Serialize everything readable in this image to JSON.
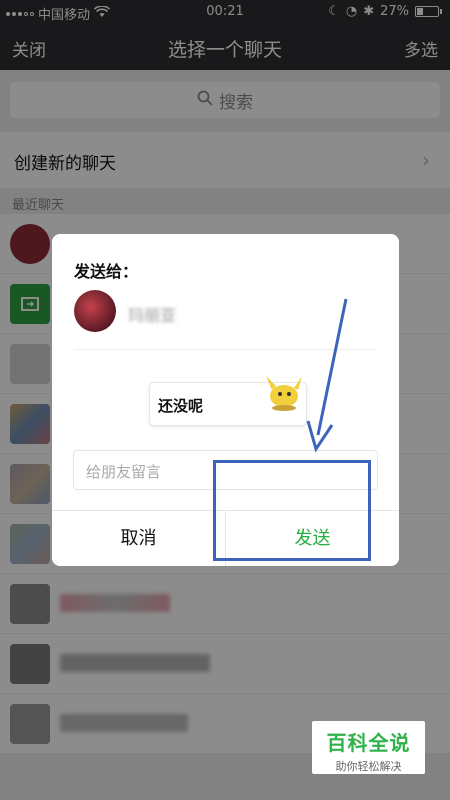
{
  "status_bar": {
    "carrier": "中国移动",
    "time": "00:21",
    "battery": "27%"
  },
  "nav": {
    "close": "关闭",
    "title": "选择一个聊天",
    "multi_select": "多选"
  },
  "search": {
    "placeholder": "搜索"
  },
  "create_chat": {
    "label": "创建新的聊天"
  },
  "recent": {
    "header": "最近聊天",
    "rows": [
      {
        "avatar_color": "#8b2b35"
      },
      {
        "avatar_color": "#2ea043"
      },
      {
        "avatar_color": "#cfcfcf"
      },
      {
        "avatar_color": "#b9a78a"
      },
      {
        "avatar_color": "#a9a3b5"
      },
      {
        "avatar_color": "#aab2a3"
      },
      {
        "avatar_color": "#8a8a8a"
      },
      {
        "avatar_color": "#7a7a7a"
      },
      {
        "avatar_color": "#9a9a9a"
      }
    ]
  },
  "dialog": {
    "send_to": "发送给：",
    "recipient_name": "玛丽亚",
    "message_preview": "还没呢",
    "input_placeholder": "给朋友留言",
    "cancel": "取消",
    "send": "发送"
  },
  "watermark": {
    "title": "百科全说",
    "subtitle": "助你轻松解决"
  },
  "colors": {
    "accent_green": "#27ad43",
    "annotation_blue": "#3d64bb",
    "nav_bg": "#2e2e32"
  }
}
